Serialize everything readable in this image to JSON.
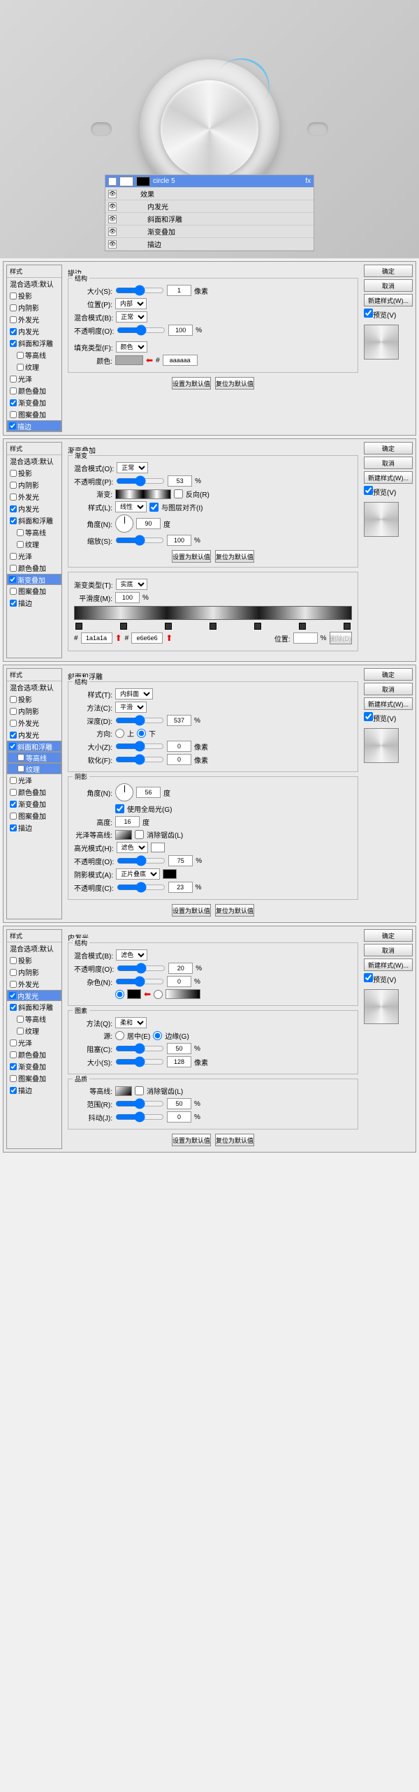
{
  "layers": {
    "title": "circle 5",
    "fx": "效果",
    "items": [
      "内发光",
      "斜面和浮雕",
      "渐变叠加",
      "描边"
    ]
  },
  "buttons": {
    "ok": "确定",
    "cancel": "取消",
    "newstyle": "新建样式(W)...",
    "preview": "预览(V)",
    "default": "设置为默认值",
    "reset": "复位为默认值",
    "delete": "删除(D)"
  },
  "sidebar": {
    "hdr": "样式",
    "blend": "混合选项:默认",
    "items": [
      "投影",
      "内阴影",
      "外发光",
      "内发光",
      "斜面和浮雕",
      "等高线",
      "纹理",
      "光泽",
      "颜色叠加",
      "渐变叠加",
      "图案叠加",
      "描边"
    ]
  },
  "p1": {
    "title": "描边",
    "struct": "结构",
    "size": "大小(S):",
    "size_v": "1",
    "px": "像素",
    "pos": "位置(P):",
    "pos_v": "内部",
    "blend": "混合模式(B):",
    "blend_v": "正常",
    "opacity": "不透明度(O):",
    "opacity_v": "100",
    "fill": "填充类型(F):",
    "fill_v": "颜色",
    "color": "颜色:",
    "hex": "aaaaaa"
  },
  "p2": {
    "title": "渐变叠加",
    "grad": "渐变",
    "blend": "混合模式(O):",
    "blend_v": "正常",
    "opacity": "不透明度(P):",
    "opacity_v": "53",
    "gradient": "渐变:",
    "reverse": "反向(R)",
    "style": "样式(L):",
    "style_v": "线性",
    "align": "与图层对齐(I)",
    "angle": "角度(N):",
    "angle_v": "90",
    "deg": "度",
    "scale": "缩放(S):",
    "scale_v": "100",
    "elem": "渐变类型(T):",
    "elem_v": "实底",
    "smooth": "平滑度(M):",
    "smooth_v": "100",
    "c1": "1a1a1a",
    "c2": "e6e6e6",
    "loc": "位置:"
  },
  "p3": {
    "title": "斜面和浮雕",
    "struct": "结构",
    "style": "样式(T):",
    "style_v": "内斜面",
    "tech": "方法(C):",
    "tech_v": "平滑",
    "depth": "深度(D):",
    "depth_v": "537",
    "dir": "方向:",
    "up": "上",
    "down": "下",
    "size": "大小(Z):",
    "size_v": "0",
    "px": "像素",
    "soft": "软化(F):",
    "soft_v": "0",
    "shade": "阴影",
    "angle": "角度(N):",
    "angle_v": "56",
    "deg": "度",
    "global": "使用全局光(G)",
    "alt": "高度:",
    "alt_v": "16",
    "gloss": "光泽等高线:",
    "anti": "消除锯齿(L)",
    "hmode": "高光模式(H):",
    "hmode_v": "滤色",
    "hop": "不透明度(O):",
    "hop_v": "75",
    "smode": "阴影模式(A):",
    "smode_v": "正片叠底",
    "sop": "不透明度(C):",
    "sop_v": "23"
  },
  "p4": {
    "title": "内发光",
    "struct": "结构",
    "blend": "混合模式(B):",
    "blend_v": "滤色",
    "opacity": "不透明度(O):",
    "opacity_v": "20",
    "noise": "杂色(N):",
    "noise_v": "0",
    "elem": "图素",
    "tech": "方法(Q):",
    "tech_v": "柔和",
    "src": "源:",
    "center": "居中(E)",
    "edge": "边缘(G)",
    "choke": "阻塞(C):",
    "choke_v": "50",
    "size": "大小(S):",
    "size_v": "128",
    "px": "像素",
    "qual": "品质",
    "contour": "等高线:",
    "anti": "消除锯齿(L)",
    "range": "范围(R):",
    "range_v": "50",
    "jitter": "抖动(J):",
    "jitter_v": "0"
  }
}
